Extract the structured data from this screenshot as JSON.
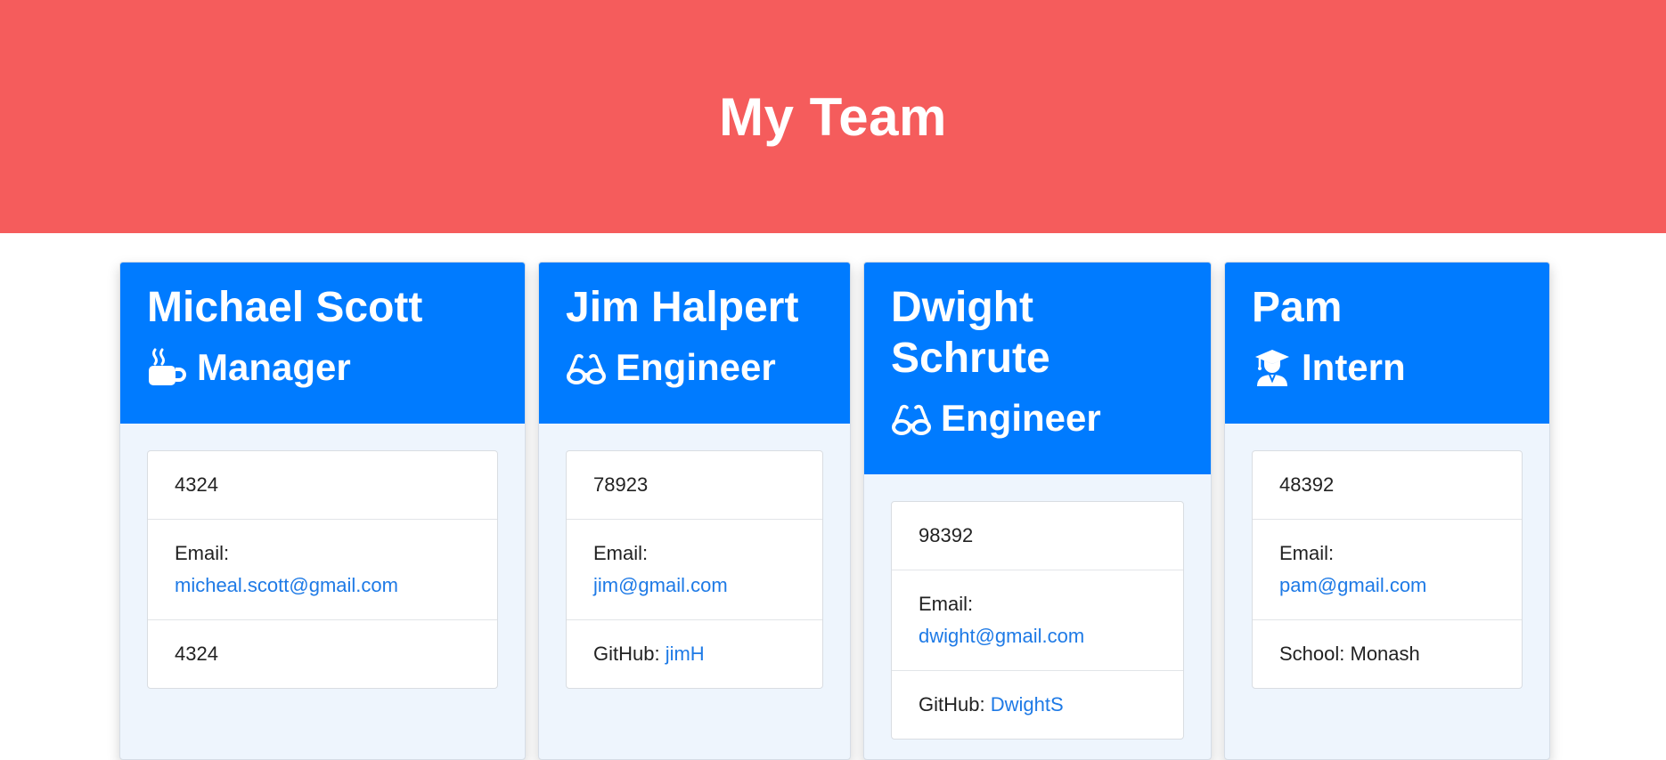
{
  "header": {
    "title": "My Team"
  },
  "members": [
    {
      "name": "Michael Scott",
      "role": "Manager",
      "role_icon": "mug-icon",
      "id": "4324",
      "email_label": "Email:",
      "email": "micheal.scott@gmail.com",
      "extra_label": "",
      "extra_value": "4324"
    },
    {
      "name": "Jim Halpert",
      "role": "Engineer",
      "role_icon": "glasses-icon",
      "id": "78923",
      "email_label": "Email:",
      "email": "jim@gmail.com",
      "extra_label": "GitHub: ",
      "extra_value": "jimH"
    },
    {
      "name": "Dwight Schrute",
      "role": "Engineer",
      "role_icon": "glasses-icon",
      "id": "98392",
      "email_label": "Email:",
      "email": "dwight@gmail.com",
      "extra_label": "GitHub: ",
      "extra_value": "DwightS"
    },
    {
      "name": "Pam",
      "role": "Intern",
      "role_icon": "graduate-icon",
      "id": "48392",
      "email_label": "Email:",
      "email": "pam@gmail.com",
      "extra_label": "School: ",
      "extra_value": "Monash"
    }
  ],
  "colors": {
    "header_bg": "#f55c5c",
    "card_header_bg": "#007bff",
    "card_body_bg": "#eef5fd",
    "link": "#1e7ae6"
  }
}
